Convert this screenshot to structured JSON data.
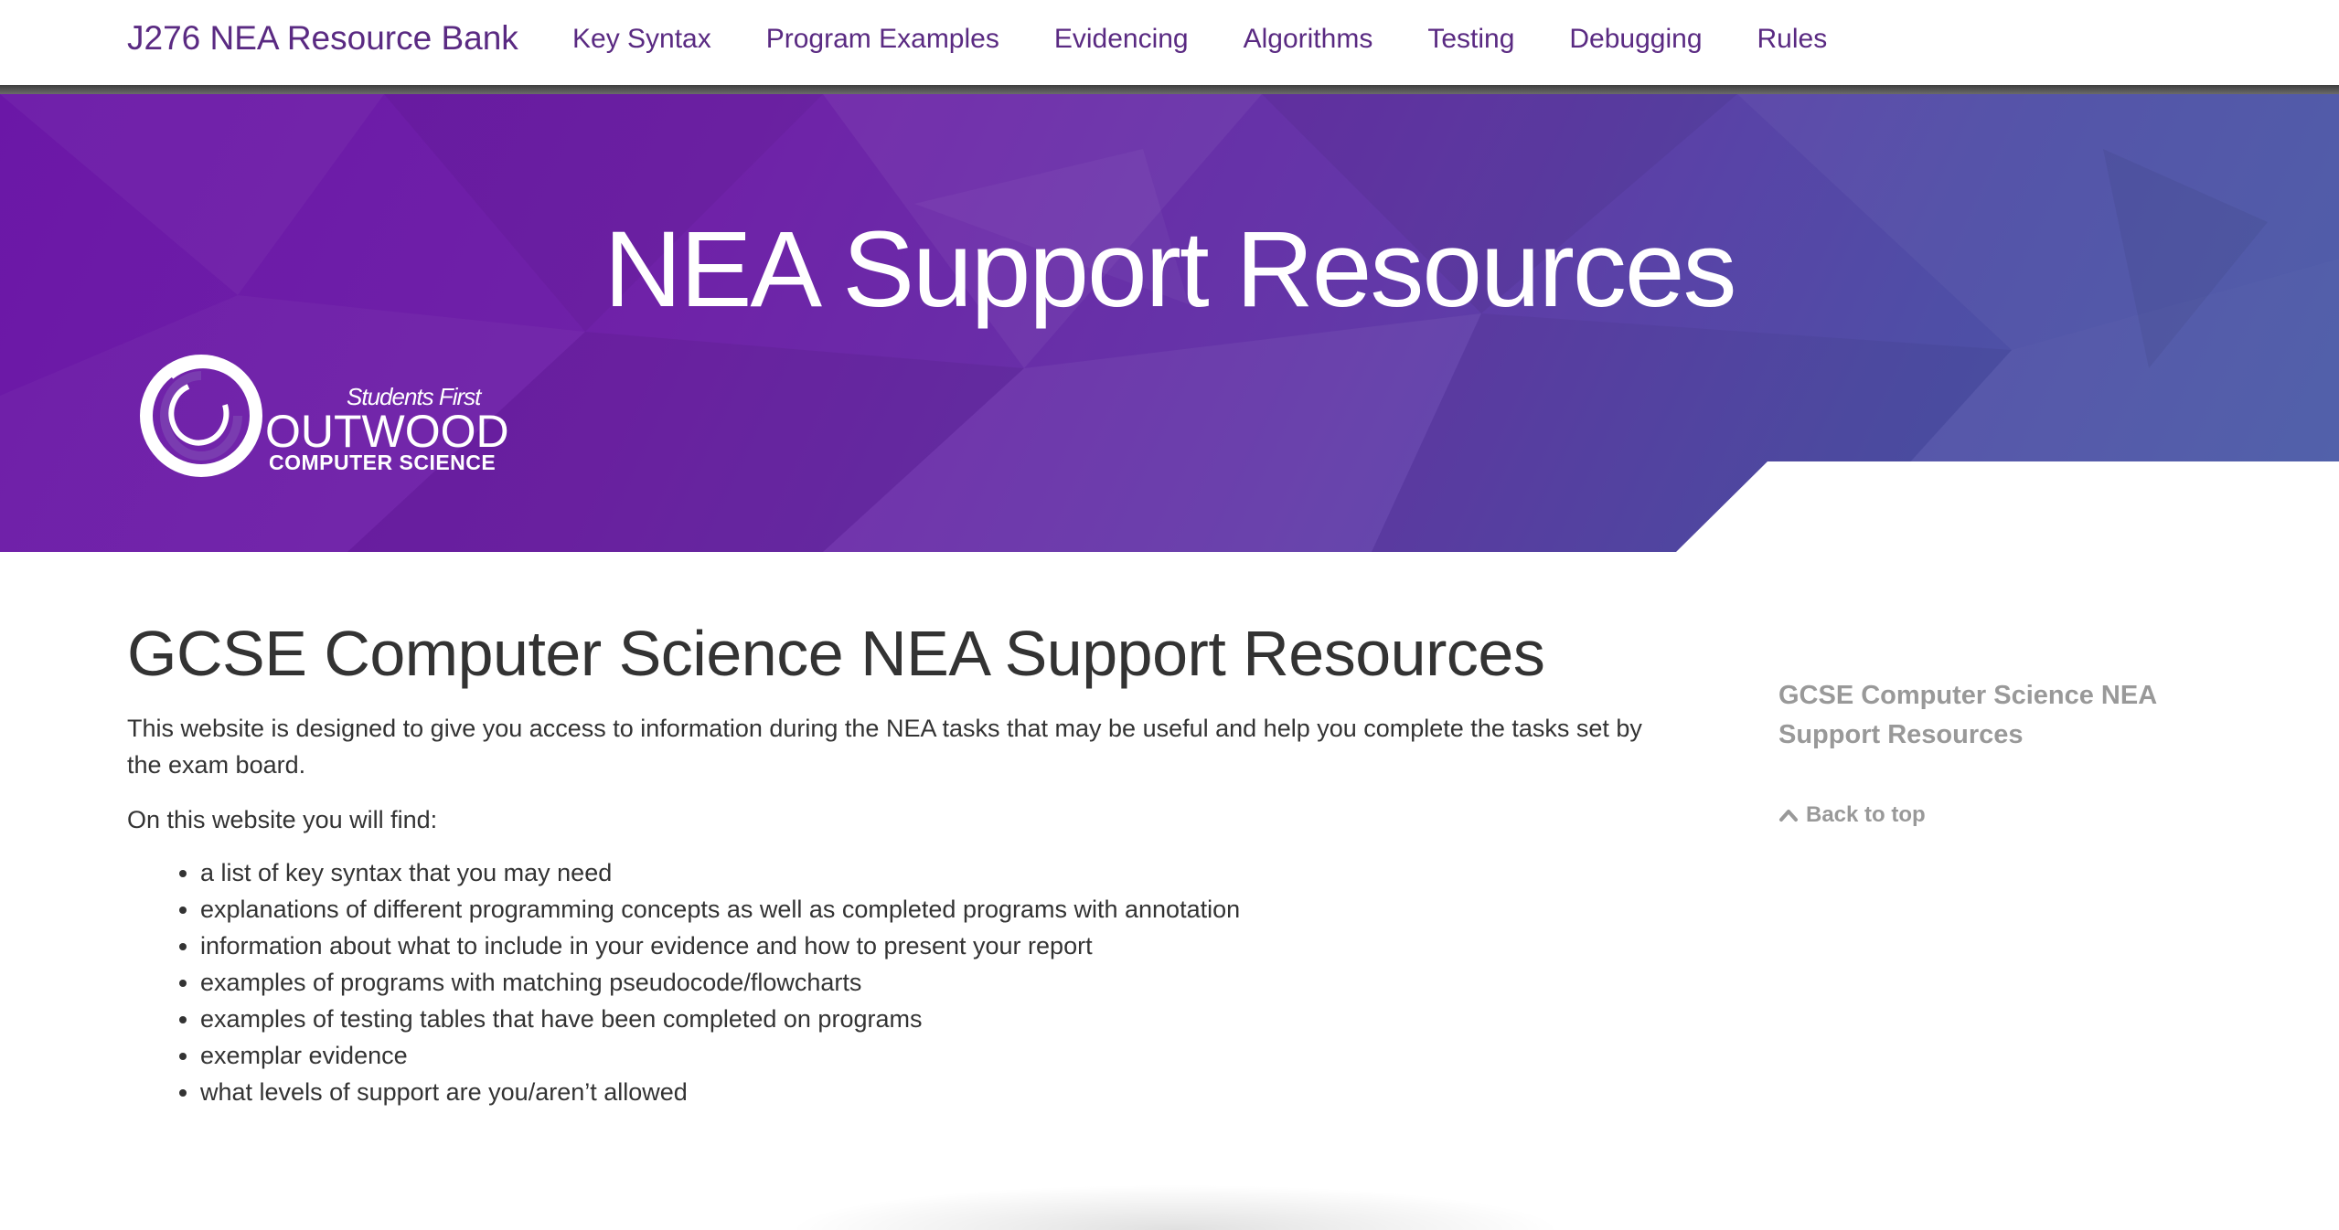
{
  "navbar": {
    "brand": "J276 NEA Resource Bank",
    "links": [
      {
        "label": "Key Syntax"
      },
      {
        "label": "Program Examples"
      },
      {
        "label": "Evidencing"
      },
      {
        "label": "Algorithms"
      },
      {
        "label": "Testing"
      },
      {
        "label": "Debugging"
      },
      {
        "label": "Rules"
      }
    ]
  },
  "hero": {
    "title": "NEA Support Resources",
    "logo": {
      "tagline": "Students First",
      "name": "OUTWOOD",
      "subtitle": "COMPUTER SCIENCE"
    }
  },
  "main": {
    "title": "GCSE Computer Science NEA Support Resources",
    "intro": "This website is designed to give you access to information during the NEA tasks that may be useful and help you complete the tasks set by the exam board.",
    "find_label": "On this website you will find:",
    "items": [
      "a list of key syntax that you may need",
      "explanations of different programming concepts as well as completed programs with annotation",
      "information about what to include in your evidence and how to present your report",
      "examples of programs with matching pseudocode/flowcharts",
      "examples of testing tables that have been completed on programs",
      "exemplar evidence",
      "what levels of support are you/aren’t allowed"
    ]
  },
  "sidebar": {
    "toc_label": "GCSE Computer Science NEA Support Resources",
    "back_to_top": "Back to top"
  },
  "colors": {
    "brand_purple": "#5a2a82",
    "hero_start": "#6b17a7",
    "hero_end": "#485aa6",
    "sidebar_grey": "#999999",
    "text": "#333333"
  },
  "icons": {
    "back_to_top": "chevron-up-icon"
  }
}
